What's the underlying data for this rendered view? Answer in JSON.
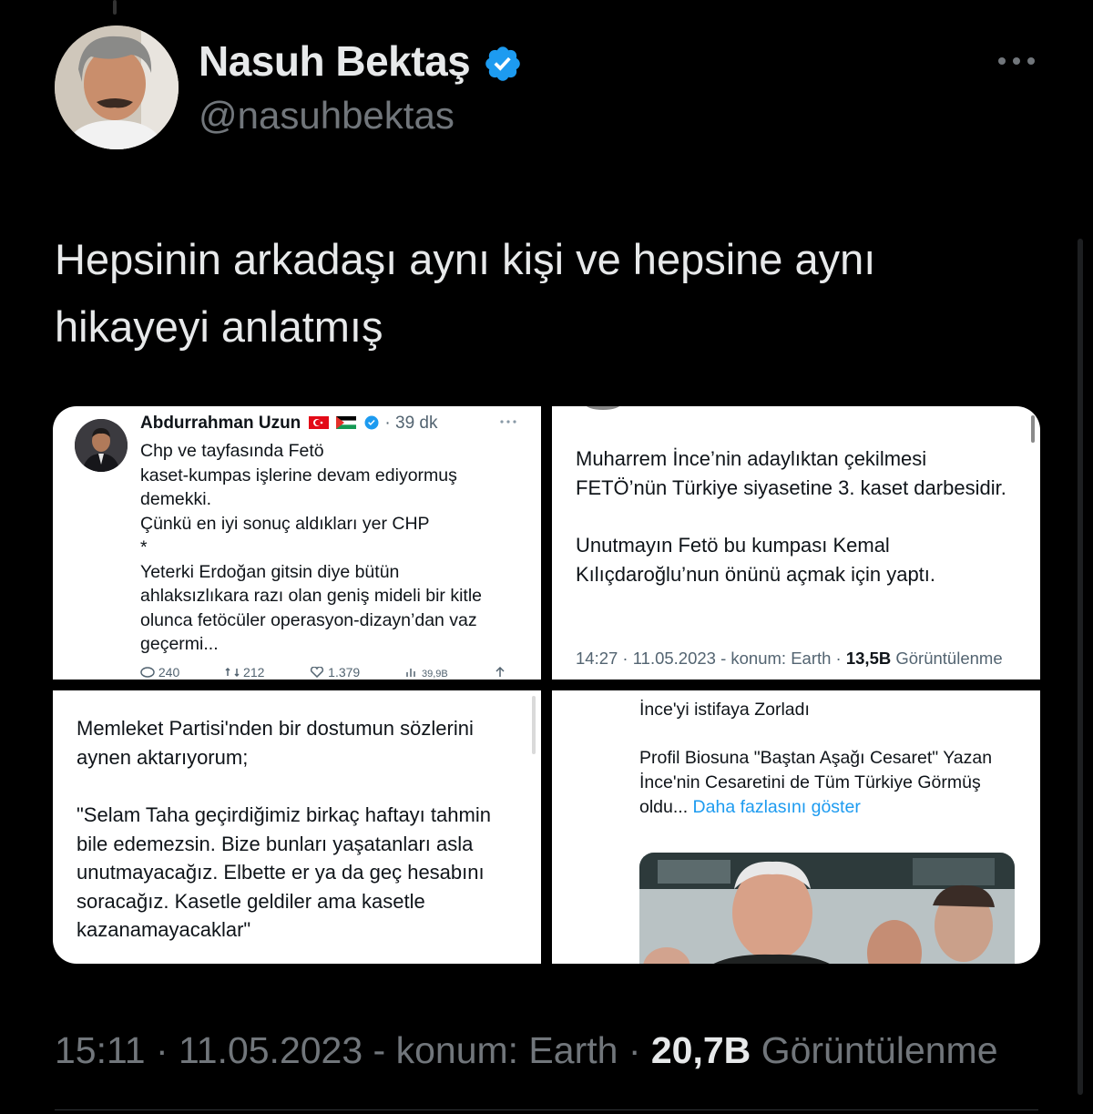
{
  "tweet": {
    "author_name": "Nasuh Bektaş",
    "handle": "@nasuhbektas",
    "text_line1": "Hepsinin arkadaşı aynı kişi ve hepsine aynı",
    "text_line2": "hikayeyi anlatmış",
    "verified_icon": "verified-badge-icon",
    "accent_color": "#1d9bf0"
  },
  "images": {
    "tile1": {
      "name": "Abdurrahman Uzun",
      "time": "· 39 dk",
      "lines": [
        "Chp ve tayfasında Fetö",
        "kaset-kumpas işlerine devam ediyormuş",
        "demekki.",
        "Çünkü en iyi sonuç aldıkları yer CHP",
        "*",
        "Yeterki Erdoğan gitsin diye bütün",
        "ahlaksızlıkara razı olan geniş mideli bir kitle",
        "olunca fetöcüler operasyon-dizayn’dan vaz",
        "geçermi..."
      ],
      "replies": "240",
      "retweets": "212",
      "likes": "1.379",
      "views": "39,9B"
    },
    "tile2": {
      "para1": "Muharrem İnce’nin adaylıktan çekilmesi FETÖ’nün Türkiye siyasetine 3. kaset darbesidir.",
      "para2": "Unutmayın Fetö bu kumpası Kemal Kılıçdaroğlu’nun önünü açmak için yaptı.",
      "foot_prefix": "14:27 · 11.05.2023 - konum: Earth ·",
      "foot_views": "13,5B",
      "foot_suffix": "Görüntülenme"
    },
    "tile3": {
      "para1": "Memleket Partisi'nden bir dostumun sözlerini aynen aktarıyorum;",
      "para2": "\"Selam Taha geçirdiğimiz birkaç haftayı tahmin bile edemezsin. Bize bunları yaşatanları asla unutmayacağız. Elbette er ya da geç hesabını soracağız. Kasetle geldiler ama kasetle kazanamayacaklar\""
    },
    "tile4": {
      "line1": "İnce'yi istifaya Zorladı",
      "para": "Profil Biosuna \"Baştan Aşağı Cesaret\" Yazan İnce'nin Cesaretini de Tüm Türkiye Görmüş oldu...",
      "more_link": "Daha fazlasını göster"
    }
  },
  "footer": {
    "time_date": "15:11 · 11.05.2023 - konum: Earth ·",
    "views": "20,7B",
    "views_label": "Görüntülenme"
  }
}
